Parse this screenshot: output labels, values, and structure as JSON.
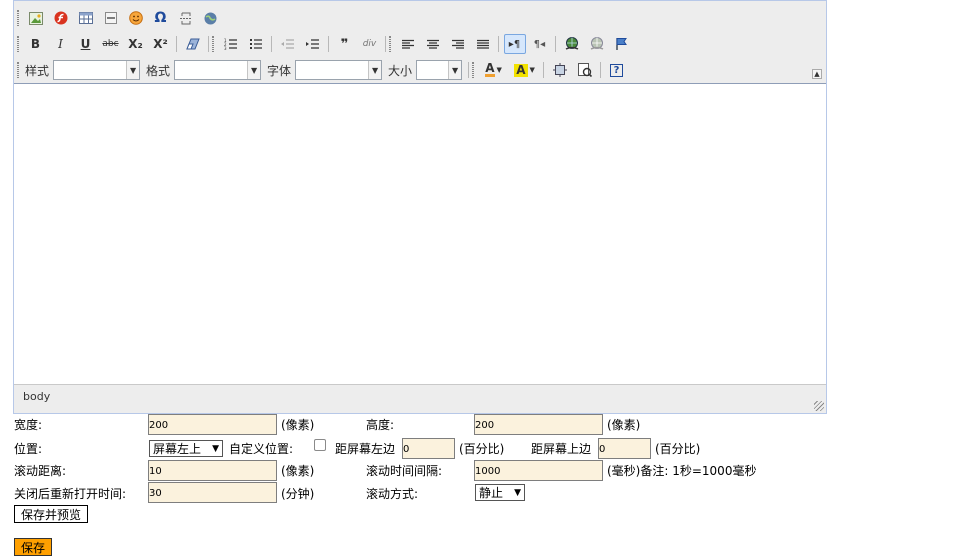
{
  "toolbar": {
    "row1_icons": [
      "image-icon",
      "flash-icon",
      "table-icon",
      "horizontal-rule-icon",
      "smiley-icon",
      "special-char-icon",
      "page-break-icon",
      "iframe-icon"
    ],
    "bold": "B",
    "italic": "I",
    "underline": "U",
    "strike": "abc",
    "subscript": "X₂",
    "superscript": "X²",
    "blockquote": "❞",
    "div": "div",
    "ltr": "▸¶",
    "rtl": "¶◂",
    "styles_label": "样式",
    "format_label": "格式",
    "font_label": "字体",
    "size_label": "大小",
    "text_color": "A",
    "bg_color": "A",
    "help": "?"
  },
  "editor": {
    "content": "",
    "status_path": "body"
  },
  "form": {
    "width_label": "宽度:",
    "width_value": "200",
    "width_unit": "(像素)",
    "height_label": "高度:",
    "height_value": "200",
    "height_unit": "(像素)",
    "position_label": "位置:",
    "position_value": "屏幕左上",
    "custom_position_label": "自定义位置:",
    "left_label": "距屏幕左边",
    "left_value": "0",
    "left_unit": "(百分比)",
    "top_label": "距屏幕上边",
    "top_value": "0",
    "top_unit": "(百分比)",
    "scroll_distance_label": "滚动距离:",
    "scroll_distance_value": "10",
    "scroll_distance_unit": "(像素)",
    "scroll_interval_label": "滚动时间间隔:",
    "scroll_interval_value": "1000",
    "scroll_interval_unit": "(毫秒)备注: 1秒=1000毫秒",
    "reopen_label": "关闭后重新打开时间:",
    "reopen_value": "30",
    "reopen_unit": "(分钟)",
    "scroll_mode_label": "滚动方式:",
    "scroll_mode_value": "静止",
    "save_preview_button": "保存并预览",
    "save_button": "保存"
  },
  "colors": {
    "input_bg": "#fbf2dd",
    "save_button_bg": "#ffa000",
    "editor_border": "#b7c8e8"
  }
}
